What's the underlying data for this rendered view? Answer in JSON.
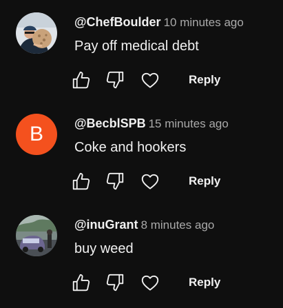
{
  "reply_label": "Reply",
  "colors": {
    "background": "#0f0f0f",
    "text": "#f1f1f1",
    "secondary_text": "#aaaaaa",
    "letter_avatar_bg": "#f4511e"
  },
  "icons": {
    "like": "thumbs-up-icon",
    "dislike": "thumbs-down-icon",
    "heart": "heart-icon"
  },
  "comments": [
    {
      "author": "@ChefBoulder",
      "time": "10 minutes ago",
      "text": "Pay off medical debt",
      "avatar": "photo"
    },
    {
      "author": "@BecblSPB",
      "time": "15 minutes ago",
      "text": "Coke and hookers",
      "avatar": "letter",
      "avatar_letter": "B"
    },
    {
      "author": "@inuGrant",
      "time": "8 minutes ago",
      "text": "buy weed",
      "avatar": "photo"
    }
  ]
}
